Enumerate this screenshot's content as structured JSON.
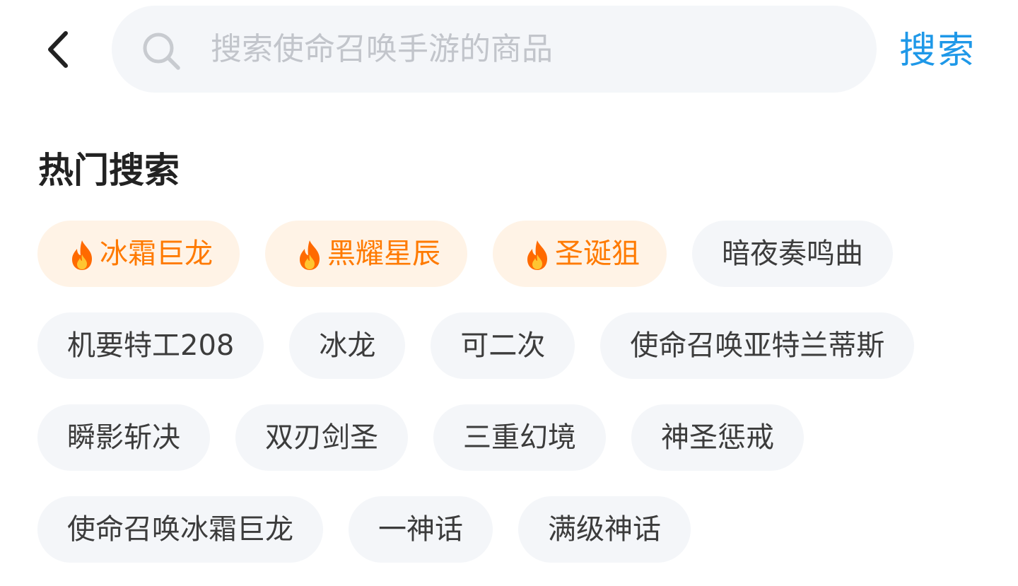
{
  "header": {
    "back_icon": "chevron-left-icon",
    "search": {
      "icon": "search-icon",
      "value": "",
      "placeholder": "搜索使命召唤手游的商品"
    },
    "submit_label": "搜索",
    "accent_color": "#1e98e8"
  },
  "hot_search": {
    "title": "热门搜索",
    "hot_color": "#ff7a00",
    "hot_background": "#fff3e6",
    "tags": [
      {
        "label": "冰霜巨龙",
        "hot": true
      },
      {
        "label": "黑耀星辰",
        "hot": true
      },
      {
        "label": "圣诞狙",
        "hot": true
      },
      {
        "label": "暗夜奏鸣曲",
        "hot": false
      },
      {
        "label": "机要特工208",
        "hot": false
      },
      {
        "label": "冰龙",
        "hot": false
      },
      {
        "label": "可二次",
        "hot": false
      },
      {
        "label": "使命召唤亚特兰蒂斯",
        "hot": false
      },
      {
        "label": "瞬影斩决",
        "hot": false
      },
      {
        "label": "双刃剑圣",
        "hot": false
      },
      {
        "label": "三重幻境",
        "hot": false
      },
      {
        "label": "神圣惩戒",
        "hot": false
      },
      {
        "label": "使命召唤冰霜巨龙",
        "hot": false
      },
      {
        "label": "一神话",
        "hot": false
      },
      {
        "label": "满级神话",
        "hot": false
      }
    ]
  }
}
